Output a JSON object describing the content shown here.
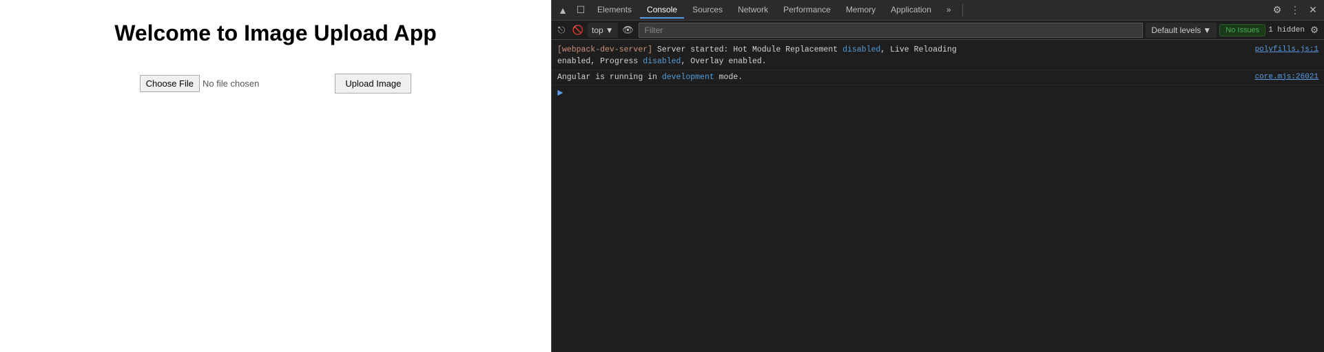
{
  "app": {
    "title": "Welcome to Image Upload App",
    "choose_file_label": "Choose File",
    "no_file_text": "No file chosen",
    "upload_button_label": "Upload Image"
  },
  "devtools": {
    "tabs": [
      {
        "label": "Elements",
        "active": false
      },
      {
        "label": "Console",
        "active": true
      },
      {
        "label": "Sources",
        "active": false
      },
      {
        "label": "Network",
        "active": false
      },
      {
        "label": "Performance",
        "active": false
      },
      {
        "label": "Memory",
        "active": false
      },
      {
        "label": "Application",
        "active": false
      }
    ],
    "console_level": "top",
    "filter_placeholder": "Filter",
    "default_levels_label": "Default levels",
    "no_issues_label": "No Issues",
    "hidden_label": "1 hidden",
    "console_lines": [
      {
        "message": "[webpack-dev-server] Server started: Hot Module Replacement disabled, Live Reloading\nenabled, Progress disabled, Overlay enabled.",
        "source": "polyfills.js:1"
      },
      {
        "message": "Angular is running in development mode.",
        "source": "core.mjs:26021"
      }
    ]
  }
}
